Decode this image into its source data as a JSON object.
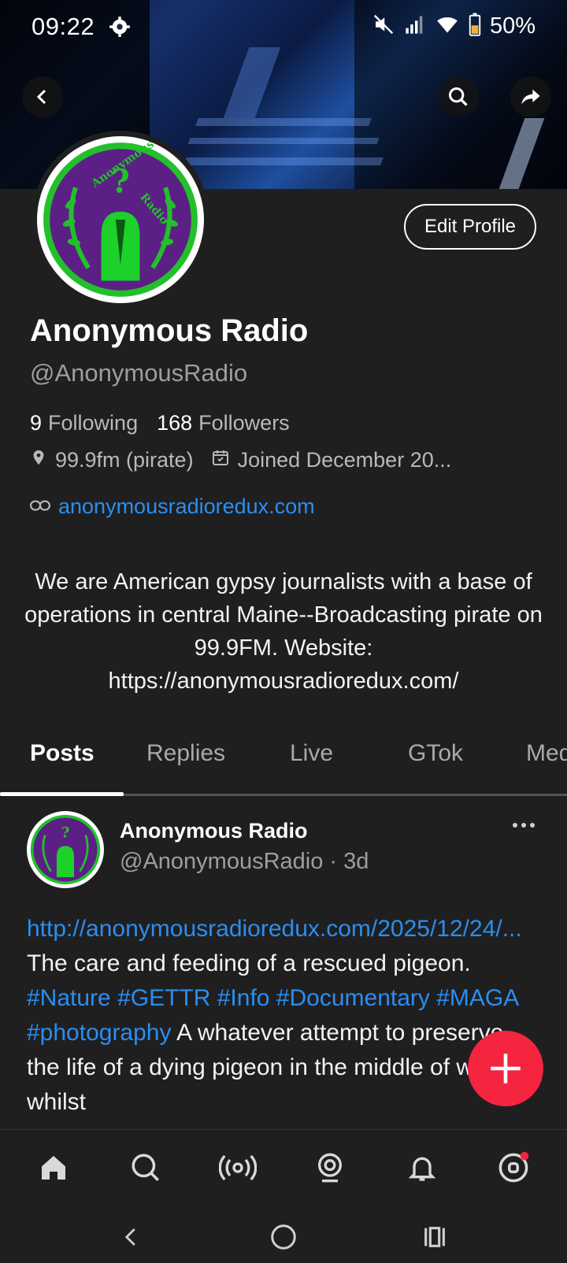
{
  "status_bar": {
    "time": "09:22",
    "battery": "50%",
    "icons": [
      "gear-icon",
      "mute-icon",
      "signal-icon",
      "wifi-icon",
      "battery-icon"
    ]
  },
  "header": {
    "back_icon": "chevron-left-icon",
    "search_icon": "search-icon",
    "share_icon": "share-icon"
  },
  "profile": {
    "edit_label": "Edit Profile",
    "name": "Anonymous Radio",
    "handle": "@AnonymousRadio",
    "following_count": "9",
    "following_label": "Following",
    "followers_count": "168",
    "followers_label": "Followers",
    "location": "99.9fm (pirate)",
    "joined": "Joined December 20...",
    "website": "anonymousradioredux.com",
    "bio": "We are American gypsy journalists with a base of operations in central Maine--Broadcasting pirate on 99.9FM. Website: https://anonymousradioredux.com/"
  },
  "tabs": [
    {
      "label": "Posts",
      "active": true
    },
    {
      "label": "Replies"
    },
    {
      "label": "Live"
    },
    {
      "label": "GTok"
    },
    {
      "label": "Med"
    }
  ],
  "post": {
    "author": "Anonymous Radio",
    "handle_time": "@AnonymousRadio · 3d",
    "link": "http://anonymousradioredux.com/2025/12/24/...",
    "text1": " The care and feeding of a rescued pigeon. ",
    "hashtags": "#Nature #GETTR #Info #Documentary #MAGA #photography",
    "text2": " A whatever attempt to preserve the life of a dying pigeon in the middle of winter whilst"
  },
  "colors": {
    "background": "#1f1f20",
    "link": "#2b8ef0",
    "fab": "#f5243f",
    "logo_purple": "#5b1f86",
    "logo_green": "#22c02a"
  },
  "bottom_nav": [
    "home-icon",
    "search-icon",
    "live-icon",
    "gtok-icon",
    "bell-icon",
    "circle-icon"
  ],
  "system_nav": [
    "back-icon",
    "home-icon",
    "recents-icon"
  ]
}
